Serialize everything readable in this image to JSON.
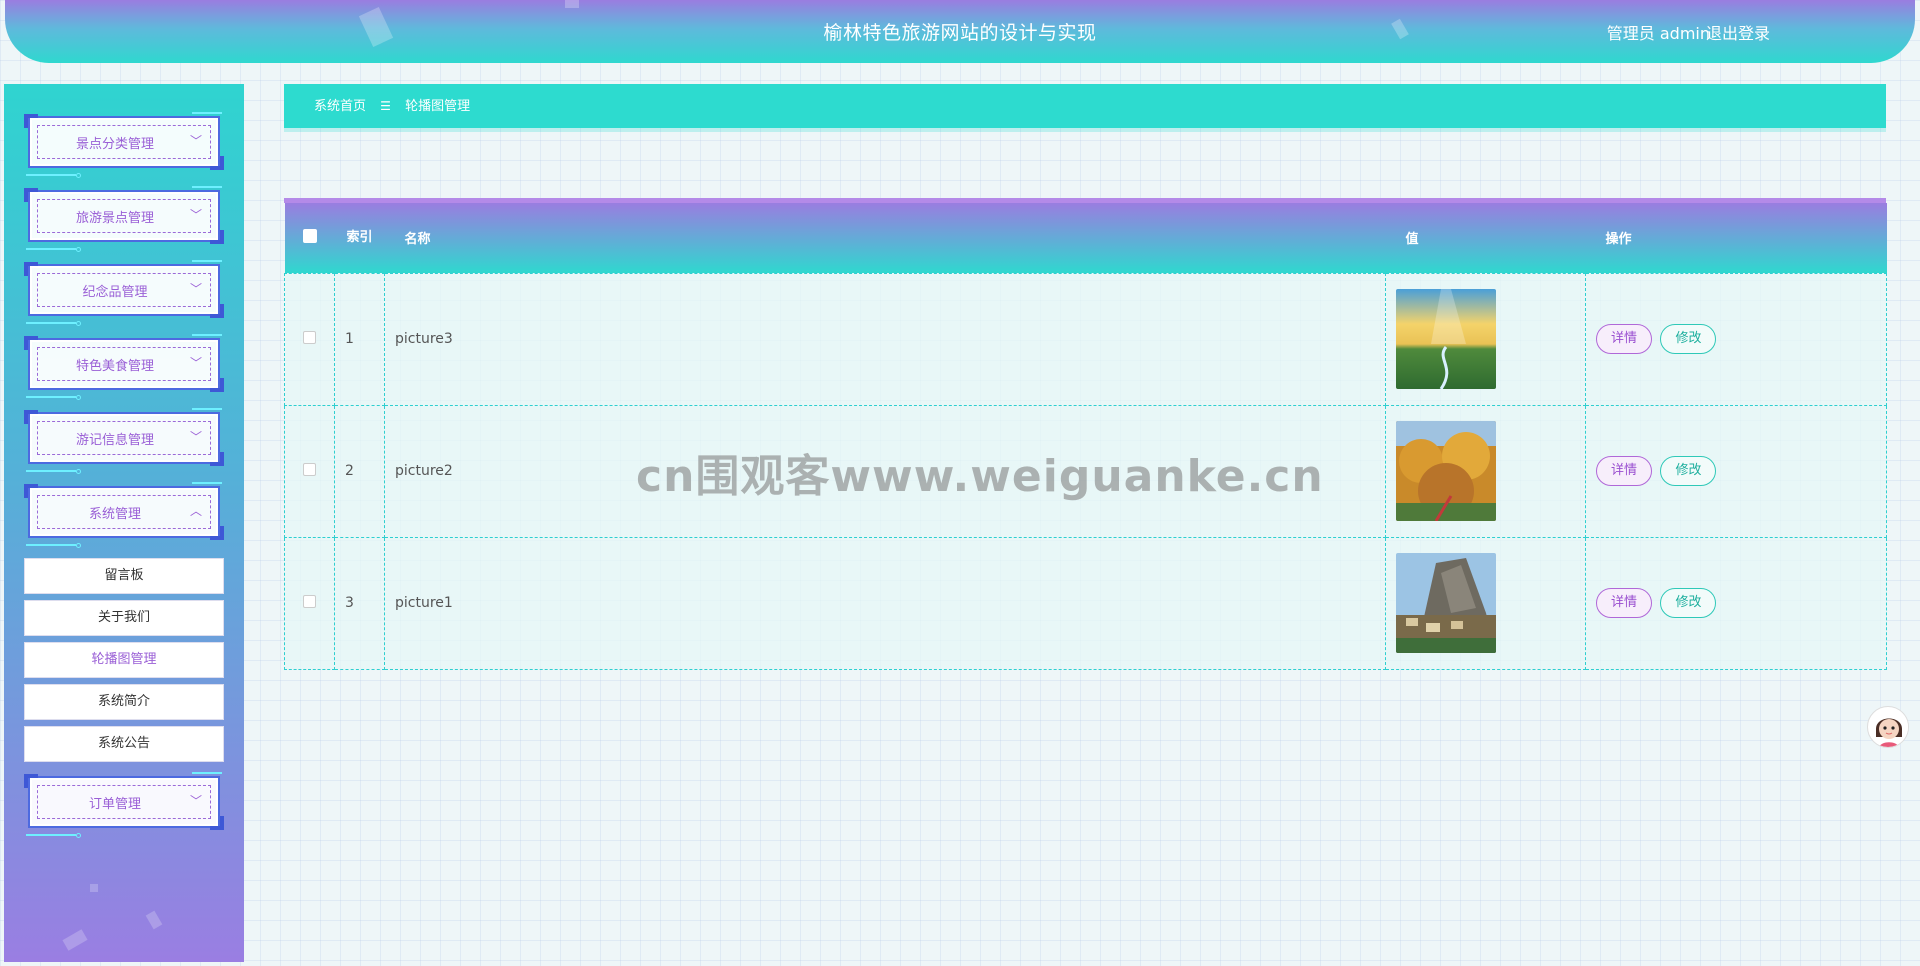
{
  "header": {
    "title": "榆林特色旅游网站的设计与实现",
    "user": "管理员 admin",
    "logout": "退出登录"
  },
  "sidebar": {
    "items": [
      {
        "label": "景点分类管理",
        "chevron": "chevron-down-icon"
      },
      {
        "label": "旅游景点管理",
        "chevron": "chevron-down-icon"
      },
      {
        "label": "纪念品管理",
        "chevron": "chevron-down-icon"
      },
      {
        "label": "特色美食管理",
        "chevron": "chevron-down-icon"
      },
      {
        "label": "游记信息管理",
        "chevron": "chevron-down-icon"
      },
      {
        "label": "系统管理",
        "chevron": "chevron-up-icon"
      },
      {
        "label": "订单管理",
        "chevron": "chevron-down-icon"
      }
    ],
    "submenu": [
      {
        "label": "留言板"
      },
      {
        "label": "关于我们"
      },
      {
        "label": "轮播图管理",
        "active": true
      },
      {
        "label": "系统简介"
      },
      {
        "label": "系统公告"
      }
    ]
  },
  "breadcrumb": {
    "home": "系统首页",
    "separator": "☰",
    "current": "轮播图管理"
  },
  "table": {
    "columns": {
      "index": "索引",
      "name": "名称",
      "value": "值",
      "actions": "操作"
    },
    "rows": [
      {
        "index": "1",
        "name": "picture3",
        "image": "sunlit-river-valley",
        "detail": "详情",
        "edit": "修改"
      },
      {
        "index": "2",
        "name": "picture2",
        "image": "autumn-forest",
        "detail": "详情",
        "edit": "修改"
      },
      {
        "index": "3",
        "name": "picture1",
        "image": "cliff-village",
        "detail": "详情",
        "edit": "修改"
      }
    ]
  },
  "watermark": "cn围观客www.weiguanke.cn",
  "colors": {
    "accent_teal": "#2ddbcf",
    "accent_purple": "#9a7de0",
    "menu_text": "#9a5fd6"
  }
}
